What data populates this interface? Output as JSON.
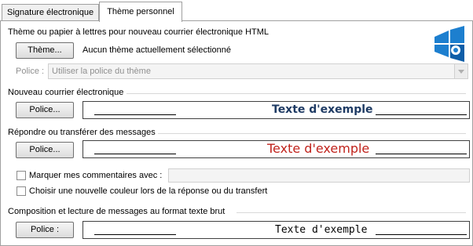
{
  "tabs": [
    {
      "label": "Signature électronique"
    },
    {
      "label": "Thème personnel"
    }
  ],
  "theme_section": {
    "title": "Thème ou papier à lettres pour nouveau courrier électronique HTML",
    "theme_button": "Thème...",
    "theme_status": "Aucun thème actuellement sélectionné",
    "font_label": "Police :",
    "font_select_value": "Utiliser la police du thème"
  },
  "new_mail": {
    "title": "Nouveau courrier électronique",
    "font_button": "Police...",
    "sample_text": "Texte d'exemple",
    "sample_color": "#1f3b64"
  },
  "reply": {
    "title": "Répondre ou transférer des messages",
    "font_button": "Police...",
    "sample_text": "Texte d'exemple",
    "sample_color": "#c0231c",
    "mark_comments_label": "Marquer mes commentaires avec :",
    "new_color_label": "Choisir une nouvelle couleur lors de la réponse ou du transfert"
  },
  "plain_text": {
    "title": "Composition et lecture de messages au format texte brut",
    "font_button": "Police :",
    "sample_text": "Texte d'exemple",
    "sample_color": "#000000"
  },
  "logo": {
    "name": "windows-logo-icon",
    "colors": [
      "#1d7fcf",
      "#0e5ea8"
    ]
  }
}
